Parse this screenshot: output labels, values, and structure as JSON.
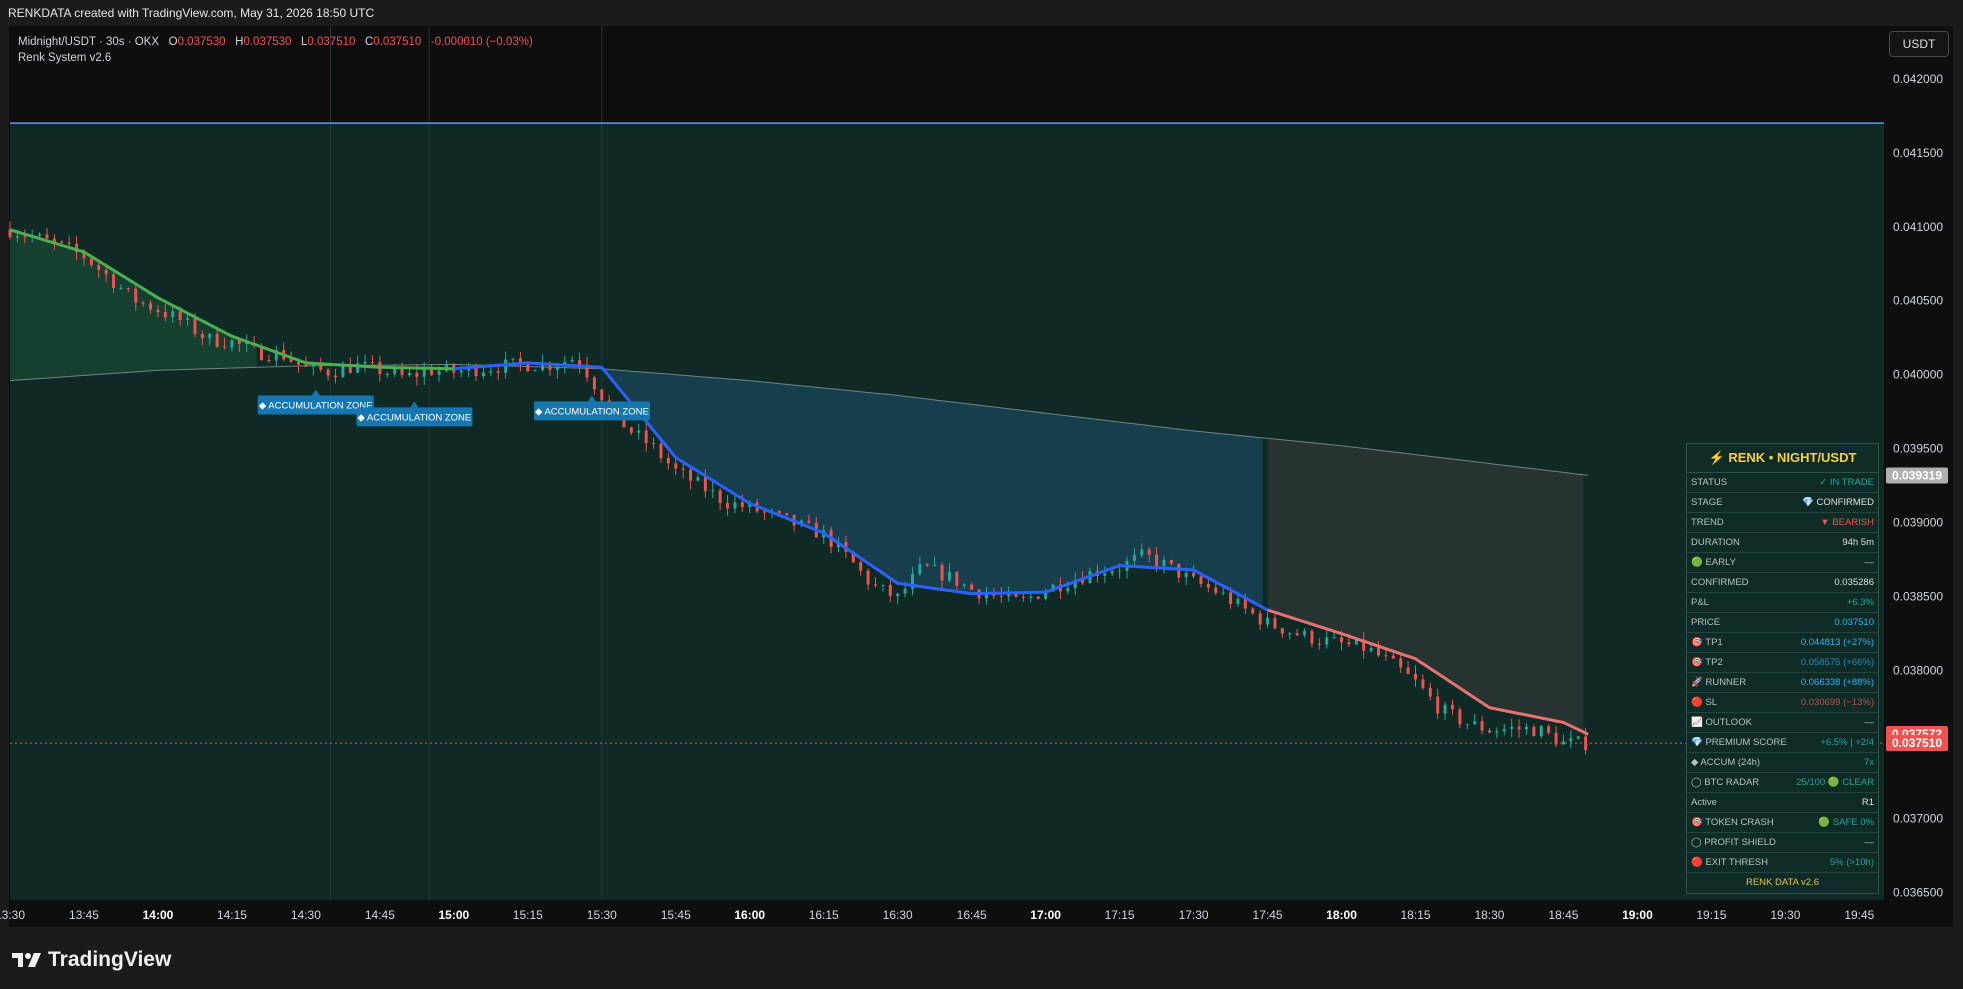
{
  "header": {
    "caption": "RENKDATA created with TradingView.com, May 31, 2026 18:50 UTC"
  },
  "legend": {
    "symbol": "Midnight/USDT · 30s · OKX",
    "o_label": "O",
    "o": "0.037530",
    "h_label": "H",
    "h": "0.037530",
    "l_label": "L",
    "l": "0.037510",
    "c_label": "C",
    "c": "0.037510",
    "change": "-0.000010 (−0.03%)",
    "indicator": "Renk System v2.6"
  },
  "currency_button": "USDT",
  "colors": {
    "up": "#26a69a",
    "down": "#ef5350",
    "ema_green": "#4caf50",
    "ema_blue": "#2962ff",
    "ema_red": "#e57373",
    "hline": "#5b9cf6",
    "zone_bg": "#0f2a24",
    "panel_bg": "#0f2b26",
    "accent": "#f5d142"
  },
  "chart_data": {
    "type": "line",
    "title": "",
    "xlabel": "",
    "ylabel": "",
    "x_ticks": [
      "13:30",
      "13:45",
      "14:00",
      "14:15",
      "14:30",
      "14:45",
      "15:00",
      "15:15",
      "15:30",
      "15:45",
      "16:00",
      "16:15",
      "16:30",
      "16:45",
      "17:00",
      "17:15",
      "17:30",
      "17:45",
      "18:00",
      "18:15",
      "18:30",
      "18:45",
      "19:00",
      "19:15",
      "19:30",
      "19:45"
    ],
    "y_ticks": [
      "0.042000",
      "0.041500",
      "0.041000",
      "0.040500",
      "0.040000",
      "0.039500",
      "0.039000",
      "0.038500",
      "0.038000",
      "0.037500",
      "0.037000",
      "0.036500"
    ],
    "ylim": [
      0.03645,
      0.04235
    ],
    "xlim": [
      "13:30",
      "19:50"
    ],
    "grid": false,
    "series": [
      {
        "type": "candles-close",
        "x": [
          "13:30",
          "13:35",
          "13:40",
          "13:45",
          "13:50",
          "13:55",
          "14:00",
          "14:05",
          "14:10",
          "14:15",
          "14:20",
          "14:25",
          "14:30",
          "14:35",
          "14:40",
          "14:45",
          "14:50",
          "14:55",
          "15:00",
          "15:05",
          "15:10",
          "15:15",
          "15:20",
          "15:25",
          "15:30",
          "15:35",
          "15:40",
          "15:45",
          "15:50",
          "15:55",
          "16:00",
          "16:05",
          "16:10",
          "16:15",
          "16:20",
          "16:25",
          "16:30",
          "16:35",
          "16:40",
          "16:45",
          "16:50",
          "16:55",
          "17:00",
          "17:05",
          "17:10",
          "17:15",
          "17:20",
          "17:25",
          "17:30",
          "17:35",
          "17:40",
          "17:45",
          "17:50",
          "17:55",
          "18:00",
          "18:05",
          "18:10",
          "18:15",
          "18:20",
          "18:25",
          "18:30",
          "18:35",
          "18:40",
          "18:45",
          "18:50"
        ],
        "values": [
          0.04098,
          0.04093,
          0.04087,
          0.0408,
          0.04066,
          0.04051,
          0.04044,
          0.04036,
          0.04024,
          0.04022,
          0.04015,
          0.04014,
          0.04004,
          0.04002,
          0.04006,
          0.04003,
          0.03998,
          0.04003,
          0.04002,
          0.04004,
          0.04006,
          0.04007,
          0.04007,
          0.04012,
          0.03986,
          0.03964,
          0.03952,
          0.03935,
          0.03925,
          0.03914,
          0.0391,
          0.03904,
          0.03898,
          0.03892,
          0.03876,
          0.03857,
          0.03849,
          0.0387,
          0.03864,
          0.03855,
          0.0385,
          0.03846,
          0.03855,
          0.03861,
          0.03867,
          0.0387,
          0.03878,
          0.0387,
          0.0386,
          0.03853,
          0.03842,
          0.03832,
          0.03826,
          0.03821,
          0.03818,
          0.03815,
          0.03805,
          0.03792,
          0.03774,
          0.03765,
          0.0376,
          0.03761,
          0.0376,
          0.03751,
          0.03751
        ]
      },
      {
        "name": "",
        "type": "ema",
        "x": [
          "13:30",
          "13:45",
          "14:00",
          "14:15",
          "14:30",
          "14:45",
          "15:00",
          "15:15",
          "15:30",
          "15:45",
          "16:00",
          "16:15",
          "16:30",
          "16:45",
          "17:00",
          "17:15",
          "17:30",
          "17:45",
          "18:00",
          "18:15",
          "18:30",
          "18:45",
          "18:50"
        ],
        "values": [
          0.04098,
          0.04083,
          0.04052,
          0.04026,
          0.04008,
          0.04005,
          0.04004,
          0.04008,
          0.04005,
          0.03944,
          0.03913,
          0.03893,
          0.03859,
          0.03852,
          0.03853,
          0.03871,
          0.03868,
          0.03841,
          0.03825,
          0.03808,
          0.03775,
          0.03765,
          0.03757
        ],
        "segment_colors": [
          "#4caf50",
          "#2962ff",
          "#e57373"
        ],
        "segment_breaks": [
          "15:00",
          "17:45"
        ]
      },
      {
        "name": "",
        "type": "long-ma",
        "x": [
          "13:30",
          "14:00",
          "14:30",
          "15:00",
          "15:30",
          "16:00",
          "16:30",
          "17:00",
          "17:30",
          "18:00",
          "18:30",
          "18:50"
        ],
        "values": [
          0.03996,
          0.04003,
          0.04006,
          0.04007,
          0.04004,
          0.03996,
          0.03986,
          0.03974,
          0.03962,
          0.03952,
          0.0394,
          0.03932
        ]
      }
    ],
    "horizontal_line": 0.0417,
    "trade_zone": {
      "start": "15:30",
      "end": "17:45",
      "end_faded": "18:50"
    },
    "annotations": [
      {
        "text": "◆ ACCUMULATION ZONE",
        "x": "14:32",
        "y": 0.0399
      },
      {
        "text": "◆ ACCUMULATION ZONE",
        "x": "14:52",
        "y": 0.03982
      },
      {
        "text": "◆ ACCUMULATION ZONE",
        "x": "15:28",
        "y": 0.03986
      }
    ],
    "price_labels": [
      {
        "value": "0.039319",
        "y": 0.039319,
        "color": "#b0b0b0"
      },
      {
        "value": "0.037572",
        "y": 0.037572,
        "color": "#ef5350"
      },
      {
        "value": "0.037510",
        "y": 0.03751,
        "color": "#ef5350"
      }
    ],
    "last_price": 0.03751
  },
  "panel": {
    "title": "⚡ RENK • NIGHT/USDT",
    "rows": [
      {
        "k": "STATUS",
        "v": "✓ IN TRADE",
        "color": "#26a69a"
      },
      {
        "k": "STAGE",
        "v": "💎 CONFIRMED",
        "color": "#e0e0e0"
      },
      {
        "k": "TREND",
        "v": "▼ BEARISH",
        "color": "#ef5350"
      },
      {
        "k": "DURATION",
        "v": "94h 5m",
        "color": "#e0e0e0"
      },
      {
        "k": "🟢 EARLY",
        "v": "—",
        "color": "#b7c3c0"
      },
      {
        "k": "CONFIRMED",
        "v": "0.035286",
        "color": "#e0e0e0"
      },
      {
        "k": "P&L",
        "v": "+6.3%",
        "color": "#26a69a"
      },
      {
        "k": "PRICE",
        "v": "0.037510",
        "color": "#29b6f6"
      },
      {
        "k": "🎯 TP1",
        "v": "0.044813  (+27%)",
        "color": "#29b6f6"
      },
      {
        "k": "🎯 TP2",
        "v": "0.058575  (+66%)",
        "color": "#1e88c8"
      },
      {
        "k": "🚀 RUNNER",
        "v": "0.066338  (+88%)",
        "color": "#29b6f6"
      },
      {
        "k": "🔴 SL",
        "v": "0.030699  (−13%)",
        "color": "#c0504d"
      },
      {
        "k": "📈 OUTLOOK",
        "v": "—",
        "color": "#b7c3c0"
      },
      {
        "k": "💎 PREMIUM SCORE",
        "v": "+6.5%  |  +2/4",
        "color": "#26a69a"
      },
      {
        "k": "◆ ACCUM (24h)",
        "v": "7x",
        "color": "#26a69a"
      },
      {
        "k": "◯ BTC RADAR",
        "v": "25/100  🟢 CLEAR",
        "color": "#26a69a"
      },
      {
        "k": "  Active",
        "v": "R1",
        "color": "#e0e0e0"
      },
      {
        "k": "🎯 TOKEN CRASH",
        "v": "🟢 SAFE  0%",
        "color": "#26a69a"
      },
      {
        "k": "◯ PROFIT SHIELD",
        "v": "—",
        "color": "#b7c3c0"
      },
      {
        "k": "🔴 EXIT THRESH",
        "v": "5% (>10h)",
        "color": "#26a69a"
      }
    ],
    "footer": "RENK DATA v2.6"
  },
  "brand": {
    "name": "TradingView"
  }
}
